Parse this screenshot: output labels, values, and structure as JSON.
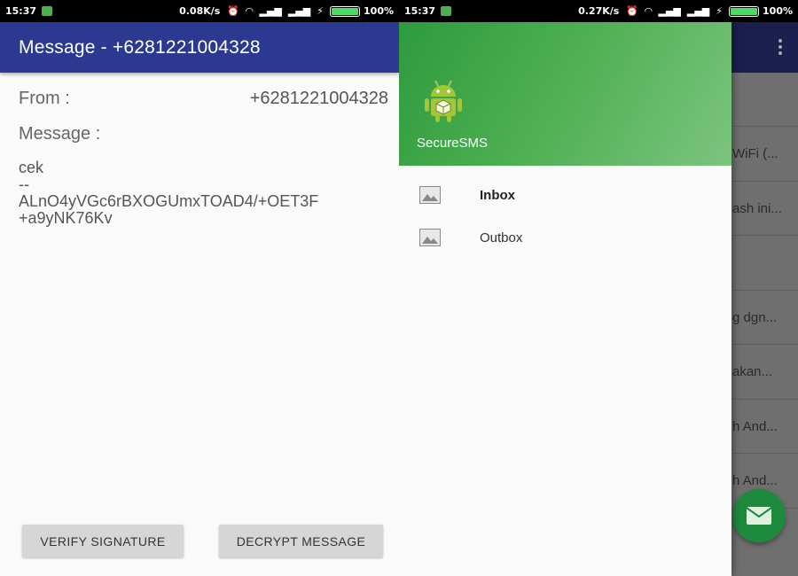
{
  "left": {
    "status": {
      "time": "15:37",
      "speed": "0.08K/s",
      "battery": "100%",
      "battery_level": 1.0
    },
    "appbar": {
      "title": "Message - +6281221004328"
    },
    "from_label": "From :",
    "from_value": "+6281221004328",
    "message_label": "Message :",
    "message_lines": [
      "cek",
      "--",
      "ALnO4yVGc6rBXOGUmxTOAD4/+OET3F",
      "+a9yNK76Kv"
    ],
    "buttons": {
      "verify": "VERIFY SIGNATURE",
      "decrypt": "DECRYPT MESSAGE"
    }
  },
  "right": {
    "status": {
      "time": "15:37",
      "speed": "0.27K/s",
      "battery": "100%",
      "battery_level": 1.0
    },
    "drawer": {
      "app_name": "SecureSMS",
      "items": [
        {
          "label": "Inbox",
          "icon": "image-icon"
        },
        {
          "label": "Outbox",
          "icon": "image-icon"
        }
      ]
    },
    "background_items": [
      "",
      "WiFi (...",
      "ash ini...",
      "",
      "g dgn...",
      "akan...",
      "h And...",
      "h And..."
    ],
    "fab_icon": "email-icon"
  },
  "colors": {
    "appbar": "#2b3990",
    "drawer_header": "#4caf50",
    "fab": "#1e8a3d",
    "button": "#d6d6d6"
  }
}
